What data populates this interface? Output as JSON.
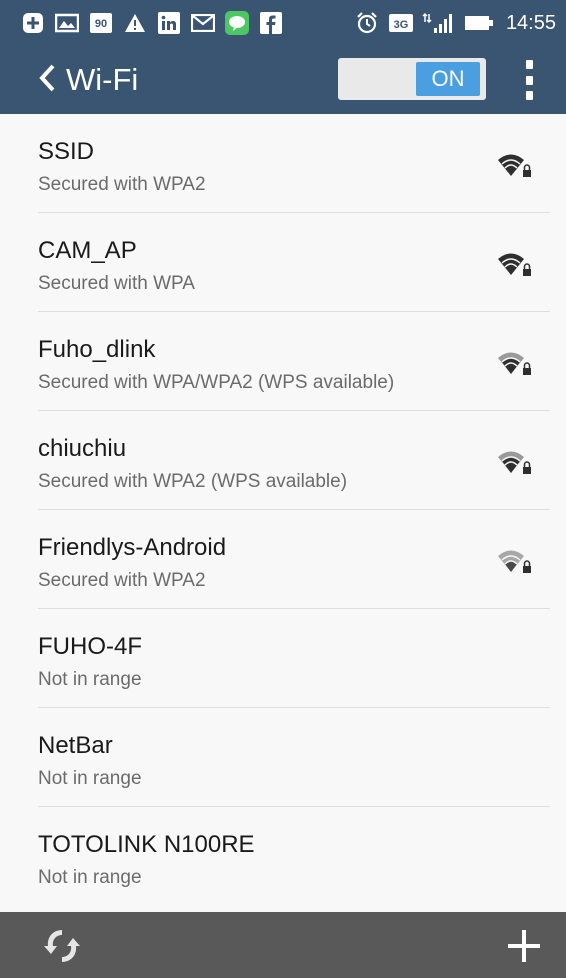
{
  "status_bar": {
    "time": "14:55",
    "notification_icons": [
      "plus-icon",
      "photo-icon",
      "badge-90-icon",
      "warning-icon",
      "linkedin-icon",
      "gmail-icon",
      "line-icon",
      "facebook-icon"
    ],
    "status_icons": [
      "alarm-icon",
      "3g-icon",
      "signal-icon",
      "battery-icon"
    ],
    "badge_90": "90",
    "network_type": "3G"
  },
  "action_bar": {
    "title": "Wi-Fi",
    "toggle_label": "ON",
    "accent": "#4a9fe0",
    "background": "#3a5572"
  },
  "networks": [
    {
      "ssid": "SSID",
      "status": "Secured with WPA2",
      "signal": "strong",
      "secured": true
    },
    {
      "ssid": "CAM_AP",
      "status": "Secured with WPA",
      "signal": "strong",
      "secured": true
    },
    {
      "ssid": "Fuho_dlink",
      "status": "Secured with WPA/WPA2 (WPS available)",
      "signal": "medium",
      "secured": true
    },
    {
      "ssid": "chiuchiu",
      "status": "Secured with WPA2 (WPS available)",
      "signal": "medium",
      "secured": true
    },
    {
      "ssid": "Friendlys-Android",
      "status": "Secured with WPA2",
      "signal": "weak",
      "secured": true
    },
    {
      "ssid": "FUHO-4F",
      "status": "Not in range",
      "signal": "none",
      "secured": false
    },
    {
      "ssid": "NetBar",
      "status": "Not in range",
      "signal": "none",
      "secured": false
    },
    {
      "ssid": "TOTOLINK N100RE",
      "status": "Not in range",
      "signal": "none",
      "secured": false
    }
  ],
  "bottom_bar": {
    "left_action": "wps-icon",
    "right_action": "add-network-icon"
  }
}
